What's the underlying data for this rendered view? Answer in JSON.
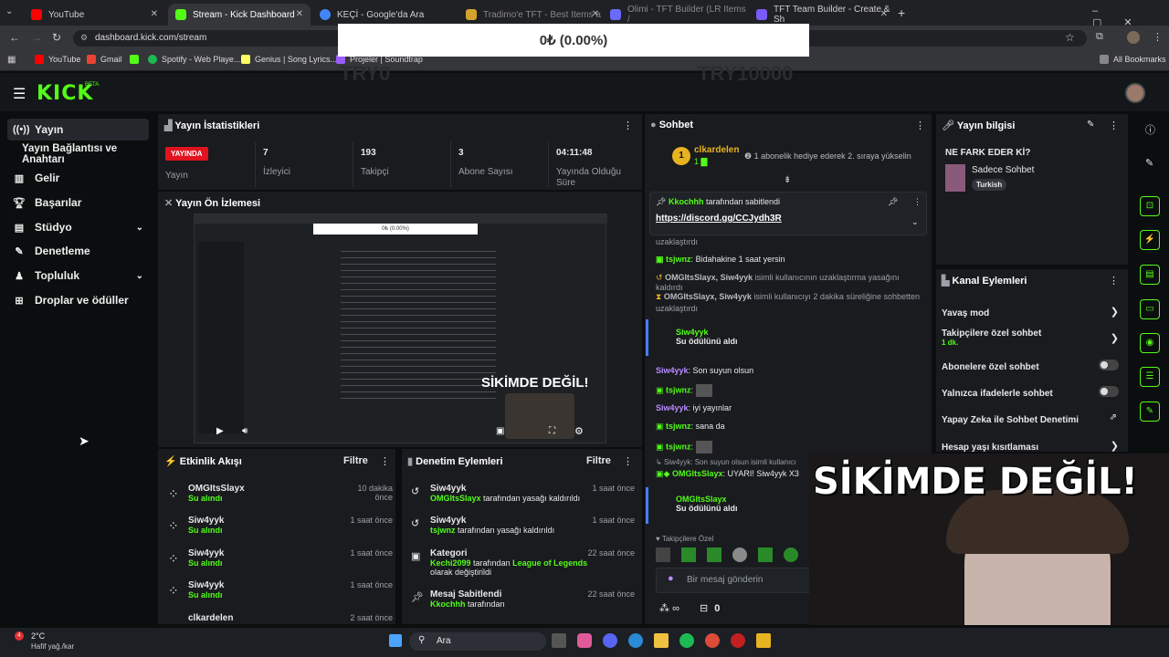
{
  "browser": {
    "tabs": [
      {
        "label": "YouTube",
        "color": "#ff0000"
      },
      {
        "label": "Stream - Kick Dashboard",
        "color": "#53fc18"
      },
      {
        "label": "KEÇİ - Google'da Ara",
        "color": "#4285f4"
      },
      {
        "label": "Tradimo'e TFT - Best Items a",
        "color": "#d4a32d"
      },
      {
        "label": "Olimi - TFT Builder (LR Items /",
        "color": "#6a6aff"
      },
      {
        "label": "TFT Team Builder - Create & Sh",
        "color": "#7a5af8"
      }
    ],
    "url": "dashboard.kick.com/stream",
    "bookmarks": [
      "YouTube",
      "Gmail",
      "Spotify - Web Playe...",
      "Genius | Song Lyrics...",
      "Projeler | Soundtrap"
    ],
    "all_bookmarks": "All Bookmarks"
  },
  "overlay": {
    "value": "0₺ (0.00%)",
    "left_faded": "TRY0",
    "right_faded": "TRY10000"
  },
  "sidebar": {
    "items": [
      {
        "label": "Yayın",
        "icon": "broadcast-icon"
      },
      {
        "label": "Yayın Bağlantısı ve Anahtarı",
        "icon": ""
      },
      {
        "label": "Gelir",
        "icon": "revenue-icon"
      },
      {
        "label": "Başarılar",
        "icon": "trophy-icon"
      },
      {
        "label": "Stüdyo",
        "icon": "studio-icon"
      },
      {
        "label": "Denetleme",
        "icon": "wrench-icon"
      },
      {
        "label": "Topluluk",
        "icon": "community-icon"
      },
      {
        "label": "Droplar ve ödüller",
        "icon": "drops-icon"
      }
    ]
  },
  "stats": {
    "title": "Yayın İstatistikleri",
    "live_badge": "YAYINDA",
    "items": [
      {
        "value": "",
        "label": "Yayın"
      },
      {
        "value": "7",
        "label": "İzleyici"
      },
      {
        "value": "193",
        "label": "Takipçi"
      },
      {
        "value": "3",
        "label": "Abone Sayısı"
      },
      {
        "value": "04:11:48",
        "label": "Yayında Olduğu Süre"
      }
    ]
  },
  "preview": {
    "title": "Yayın Ön İzlemesi",
    "overlay_text": "SİKİMDE DEĞİL!"
  },
  "activity": {
    "title": "Etkinlik Akışı",
    "filter": "Filtre",
    "items": [
      {
        "user": "OMGItsSlayx",
        "action": "Su alındı",
        "time": "10 dakika önce"
      },
      {
        "user": "Siw4yyk",
        "action": "Su alındı",
        "time": "1 saat önce"
      },
      {
        "user": "Siw4yyk",
        "action": "Su alındı",
        "time": "1 saat önce"
      },
      {
        "user": "Siw4yyk",
        "action": "Su alındı",
        "time": "1 saat önce"
      },
      {
        "user": "clkardelen",
        "action": "",
        "time": "2 saat önce"
      }
    ]
  },
  "modlog": {
    "title": "Denetim Eylemleri",
    "filter": "Filtre",
    "items": [
      {
        "user": "Siw4yyk",
        "by": "OMGItsSlayx",
        "text": "tarafından yasağı kaldırıldı",
        "time": "1 saat önce"
      },
      {
        "user": "Siw4yyk",
        "by": "tsjwnz",
        "text": "tarafından yasağı kaldırıldı",
        "time": "1 saat önce"
      },
      {
        "user": "Kategori",
        "by": "Kechi2099",
        "text": "tarafından",
        "extra": "League of Legends",
        "extra2": "olarak değiştirildi",
        "time": "22 saat önce"
      },
      {
        "user": "Mesaj Sabitlendi",
        "by": "Kkochhh",
        "text": "tarafından",
        "time": "22 saat önce"
      }
    ]
  },
  "chat": {
    "title": "Sohbet",
    "top_user": "clkardelen",
    "top_count": "1",
    "gift_text": "1 abonelik hediye ederek 2. sıraya yükselin",
    "pinned_by": "Kkochhh",
    "pinned_text": "tarafından sabitlendi",
    "pinned_link": "https://discord.gg/CCJydh3R",
    "messages": [
      {
        "text": "uzaklaştırdı"
      },
      {
        "user": "tsjwnz",
        "text": "Bidahakine 1 saat yersin"
      },
      {
        "user": "OMGItsSlayx, Siw4yyk",
        "text": "isimli kullanıcının uzaklaştırma yasağını kaldırdı"
      },
      {
        "user": "OMGItsSlayx, Siw4yyk",
        "text": "isimli kullanıcıyı 2 dakika süreliğine sohbetten uzaklaştırdı"
      },
      {
        "user": "Siw4yyk",
        "text": "Su ödülünü aldı"
      },
      {
        "user": "Siw4yyk",
        "text": "Son suyun olsun"
      },
      {
        "user": "tsjwnz",
        "text": ""
      },
      {
        "user": "Siw4yyk",
        "text": "iyi yayınlar"
      },
      {
        "user": "tsjwnz",
        "text": "sana da"
      },
      {
        "user": "tsjwnz",
        "text": ""
      },
      {
        "user": "Siw4yyk",
        "text": "Son suyun olsun isimli kullanıcı"
      },
      {
        "user": "OMGItsSlayx",
        "text": "UYARI! Siw4yyk X3"
      },
      {
        "user": "OMGItsSlayx",
        "text": "Su ödülünü aldı"
      }
    ],
    "followers_only": "Takipçilere Özel",
    "input_placeholder": "Bir mesaj gönderin",
    "infinity": "∞",
    "count": "0"
  },
  "streaminfo": {
    "title": "Yayın bilgisi",
    "stream_title": "NE FARK EDER Kİ?",
    "category": "Sadece Sohbet",
    "tag": "Turkish"
  },
  "channel": {
    "title": "Kanal Eylemleri",
    "items": [
      {
        "label": "Yavaş mod",
        "type": "arrow"
      },
      {
        "label": "Takipçilere özel sohbet",
        "sub": "1 dk.",
        "type": "arrow"
      },
      {
        "label": "Abonelere özel sohbet",
        "type": "toggle"
      },
      {
        "label": "Yalnızca ifadelerle sohbet",
        "type": "toggle"
      },
      {
        "label": "Yapay Zeka ile Sohbet Denetimi",
        "type": "link"
      },
      {
        "label": "Hesap yaşı kısıtlaması",
        "type": "arrow"
      }
    ]
  },
  "webcam_text": "SİKİMDE DEĞİL!",
  "taskbar": {
    "weather_temp": "2°C",
    "weather_desc": "Hafif yağ./kar",
    "search": "Ara",
    "notif": "4"
  }
}
